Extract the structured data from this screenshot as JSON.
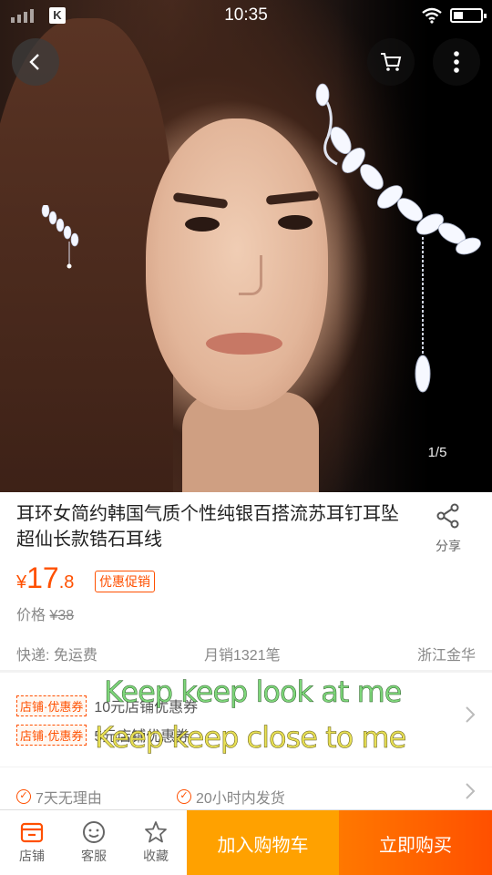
{
  "status_bar": {
    "time": "10:35",
    "carrier_badge": "K"
  },
  "gallery": {
    "counter": "1/5"
  },
  "product": {
    "title": "耳环女简约韩国气质个性纯银百搭流苏耳钉耳坠超仙长款锆石耳线",
    "share_label": "分享",
    "price_symbol": "¥",
    "price_integer": "17",
    "price_decimal": ".8",
    "promo_tag": "优惠促销",
    "original_price_label": "价格",
    "original_price": "¥38",
    "shipping": "快递: 免运费",
    "monthly_sales": "月销1321笔",
    "location": "浙江金华"
  },
  "coupons": [
    {
      "tag": "店铺·优惠券",
      "text": "10元店铺优惠券"
    },
    {
      "tag": "店铺·优惠券",
      "text": "5元店铺优惠券"
    }
  ],
  "lyrics": {
    "line1": "Keep keep look at me",
    "line2": "Keep keep close to me"
  },
  "services": [
    {
      "text": "7天无理由"
    },
    {
      "text": "20小时内发货"
    }
  ],
  "bottom_bar": {
    "store_label": "店铺",
    "service_label": "客服",
    "favorite_label": "收藏",
    "add_to_cart": "加入购物车",
    "buy_now": "立即购买"
  },
  "colors": {
    "accent": "#ff5000",
    "cart_button": "#ffa100"
  },
  "icons": [
    "back-icon",
    "cart-icon",
    "more-icon",
    "share-icon",
    "store-icon",
    "customer-service-icon",
    "star-icon",
    "check-circle-icon",
    "chevron-right-icon"
  ]
}
